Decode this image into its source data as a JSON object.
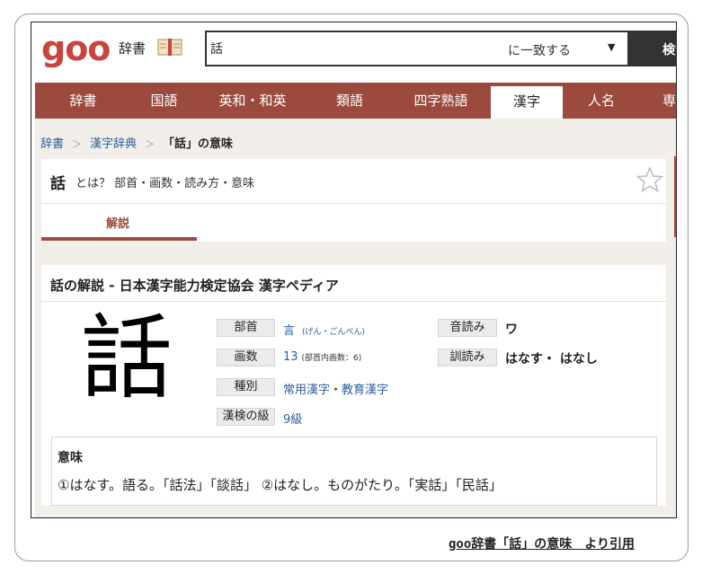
{
  "header": {
    "logo": "goo",
    "dict_label": "辞書",
    "search": {
      "value": "話",
      "match_mode": "に一致する",
      "button": "検索"
    }
  },
  "nav": {
    "tabs": [
      "辞書",
      "国語",
      "英和・和英",
      "類語",
      "四字熟語",
      "漢字",
      "人名",
      "専門"
    ],
    "active": "漢字"
  },
  "breadcrumb": {
    "items": [
      "辞書",
      "漢字辞典"
    ],
    "current": "「話」の意味"
  },
  "title": {
    "kanji": "話",
    "subtitle": "とは？ 部首・画数・読み方・意味"
  },
  "tabs": {
    "kaisetsu": "解説"
  },
  "entry": {
    "section_title": "話の解説 - 日本漢字能力検定協会 漢字ペディア",
    "kanji": "話",
    "labels": {
      "bushu": "部首",
      "kakusu": "画数",
      "shubetsu": "種別",
      "kyu": "漢検の級",
      "on": "音読み",
      "kun": "訓読み"
    },
    "bushu": {
      "value": "言",
      "note": "(げん・ごんべん)"
    },
    "kakusu": {
      "value": "13",
      "note": "(部首内画数：6)"
    },
    "shubetsu": {
      "a": "常用漢字",
      "sep": "・",
      "b": "教育漢字"
    },
    "kyu": "9級",
    "on": "ワ",
    "kun": "はなす・ はなし",
    "meaning": {
      "title": "意味",
      "text": "①はなす。語る。「話法」「談話」 ②はなし。ものがたり。「実話」「民話」"
    }
  },
  "citation": "goo辞書「話」の意味　より引用",
  "colors": {
    "brand": "#c9443c",
    "nav": "#9b4a3d",
    "link": "#2a5d9c"
  }
}
